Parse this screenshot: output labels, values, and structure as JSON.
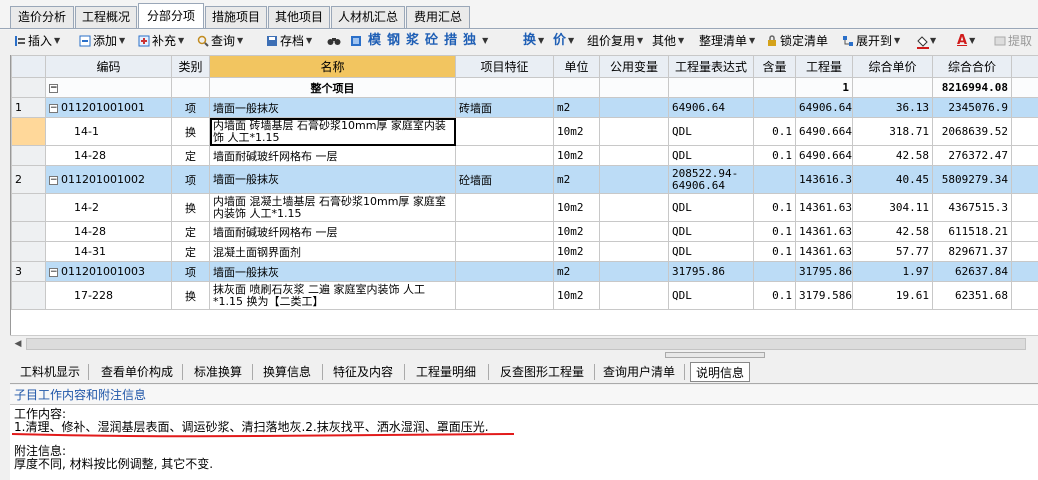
{
  "top_tabs": [
    "造价分析",
    "工程概况",
    "分部分项",
    "措施项目",
    "其他项目",
    "人材机汇总",
    "费用汇总"
  ],
  "active_tab": "分部分项",
  "toolbar": {
    "insert": "插入",
    "add": "添加",
    "supplement": "补充",
    "query": "查询",
    "save": "存档",
    "big_chars": [
      "模",
      "钢",
      "浆",
      "砼",
      "措",
      "独"
    ],
    "swap": "换",
    "price": "价",
    "group_reuse": "组价复用",
    "other": "其他",
    "organize": "整理清单",
    "lock": "锁定清单",
    "expand": "展开到",
    "extract": "提取"
  },
  "columns": [
    "编码",
    "类别",
    "名称",
    "项目特征",
    "单位",
    "公用变量",
    "工程量表达式",
    "含量",
    "工程量",
    "综合单价",
    "综合合价"
  ],
  "rows": [
    {
      "type": "top",
      "idx": "",
      "code": "",
      "cat": "",
      "name": "整个项目",
      "feature": "",
      "unit": "",
      "shared": "",
      "expr": "",
      "content": "",
      "qty": "1",
      "price": "",
      "total": "8216994.08"
    },
    {
      "type": "item",
      "idx": "1",
      "code": "011201001001",
      "cat": "项",
      "name": "墙面一般抹灰",
      "feature": "砖墙面",
      "unit": "m2",
      "shared": "",
      "expr": "64906.64",
      "content": "",
      "qty": "64906.64",
      "price": "36.13",
      "total": "2345076.9"
    },
    {
      "type": "sub",
      "idx": "",
      "code": "14-1",
      "cat": "换",
      "name": "内墙面 砖墙基层 石膏砂浆10mm厚  家庭室内装饰 人工*1.15",
      "feature": "",
      "unit": "10m2",
      "shared": "",
      "expr": "QDL",
      "content": "0.1",
      "qty": "6490.664",
      "price": "318.71",
      "total": "2068639.52",
      "tall": true,
      "selected": true
    },
    {
      "type": "sub",
      "idx": "",
      "code": "14-28",
      "cat": "定",
      "name": "墙面耐碱玻纤网格布 一层",
      "feature": "",
      "unit": "10m2",
      "shared": "",
      "expr": "QDL",
      "content": "0.1",
      "qty": "6490.664",
      "price": "42.58",
      "total": "276372.47"
    },
    {
      "type": "item",
      "idx": "2",
      "code": "011201001002",
      "cat": "项",
      "name": "墙面一般抹灰",
      "feature": "砼墙面",
      "unit": "m2",
      "shared": "",
      "expr": "208522.94-64906.64",
      "content": "",
      "qty": "143616.3",
      "price": "40.45",
      "total": "5809279.34",
      "tall": true
    },
    {
      "type": "sub",
      "idx": "",
      "code": "14-2",
      "cat": "换",
      "name": "内墙面 混凝土墙基层 石膏砂浆10mm厚  家庭室内装饰 人工*1.15",
      "feature": "",
      "unit": "10m2",
      "shared": "",
      "expr": "QDL",
      "content": "0.1",
      "qty": "14361.63",
      "price": "304.11",
      "total": "4367515.3",
      "tall": true
    },
    {
      "type": "sub",
      "idx": "",
      "code": "14-28",
      "cat": "定",
      "name": "墙面耐碱玻纤网格布 一层",
      "feature": "",
      "unit": "10m2",
      "shared": "",
      "expr": "QDL",
      "content": "0.1",
      "qty": "14361.63",
      "price": "42.58",
      "total": "611518.21"
    },
    {
      "type": "sub",
      "idx": "",
      "code": "14-31",
      "cat": "定",
      "name": "混凝土面钢界面剂",
      "feature": "",
      "unit": "10m2",
      "shared": "",
      "expr": "QDL",
      "content": "0.1",
      "qty": "14361.63",
      "price": "57.77",
      "total": "829671.37"
    },
    {
      "type": "item",
      "idx": "3",
      "code": "011201001003",
      "cat": "项",
      "name": "墙面一般抹灰",
      "feature": "",
      "unit": "m2",
      "shared": "",
      "expr": "31795.86",
      "content": "",
      "qty": "31795.86",
      "price": "1.97",
      "total": "62637.84"
    },
    {
      "type": "sub",
      "idx": "",
      "code": "17-228",
      "cat": "换",
      "name": "抹灰面 喷刷石灰浆 二遍  家庭室内装饰 人工*1.15  换为【二类工】",
      "feature": "",
      "unit": "10m2",
      "shared": "",
      "expr": "QDL",
      "content": "0.1",
      "qty": "3179.586",
      "price": "19.61",
      "total": "62351.68",
      "tall": true
    }
  ],
  "bottom_tabs": [
    "工料机显示",
    "查看单价构成",
    "标准换算",
    "换算信息",
    "特征及内容",
    "工程量明细",
    "反查图形工程量",
    "查询用户清单",
    "说明信息"
  ],
  "active_bottom_tab": "说明信息",
  "panel_title": "子目工作内容和附注信息",
  "work_label": "工作内容:",
  "work_text": "1.清理、修补、湿润基层表面、调运砂浆、清扫落地灰.2.抹灰找平、洒水湿润、罩面压光.",
  "note_label": "附注信息:",
  "note_text": "厚度不同, 材料按比例调整, 其它不变."
}
